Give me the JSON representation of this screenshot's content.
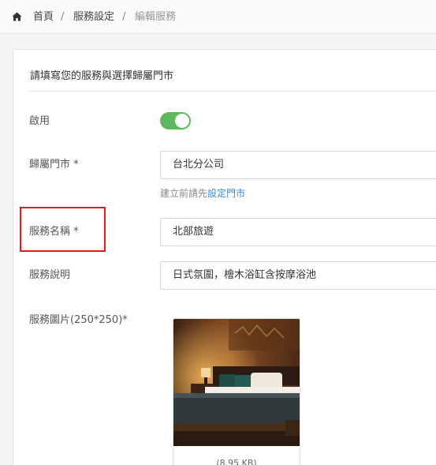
{
  "breadcrumb": {
    "home": "首頁",
    "separator": "/",
    "parent": "服務設定",
    "current": "編輯服務"
  },
  "form": {
    "title": "請填寫您的服務與選擇歸屬門市",
    "enabled_label": "啟用",
    "enabled": true,
    "store_label": "歸屬門市 *",
    "store_value": "台北分公司",
    "store_hint_prefix": "建立前請先",
    "store_hint_link": "設定門市",
    "name_label": "服務名稱 *",
    "name_value": "北部旅遊",
    "desc_label": "服務說明",
    "desc_value": "日式氛圍，檜木浴缸含按摩浴池",
    "image_label": "服務圖片(250*250)*",
    "image_size": "(8.95 KB)"
  },
  "colors": {
    "toggle_on": "#5cb85c",
    "link": "#3a8fd6",
    "highlight": "#e21b1b"
  },
  "icons": {
    "home": "home-icon"
  }
}
